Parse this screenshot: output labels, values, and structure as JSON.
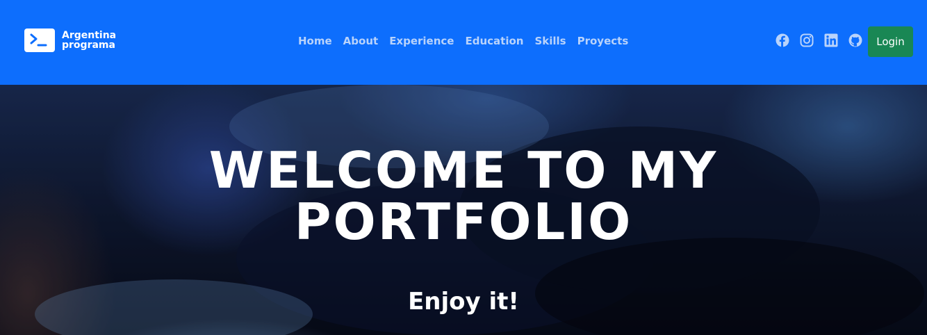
{
  "brand": {
    "line1": "Argentina",
    "line2": "programa",
    "logo_icon": "terminal-prompt-icon"
  },
  "nav": {
    "items": [
      {
        "label": "Home"
      },
      {
        "label": "About"
      },
      {
        "label": "Experience"
      },
      {
        "label": "Education"
      },
      {
        "label": "Skills"
      },
      {
        "label": "Proyects"
      }
    ]
  },
  "social": {
    "icons": [
      "facebook-icon",
      "instagram-icon",
      "linkedin-icon",
      "github-icon"
    ]
  },
  "login": {
    "label": "Login"
  },
  "hero": {
    "title_line1": "WELCOME TO MY",
    "title_line2": "PORTFOLIO",
    "subtitle": "Enjoy it!"
  },
  "colors": {
    "navbar": "#0d6efd",
    "nav_link": "#b9d3fb",
    "login_button": "#198754",
    "text": "#ffffff"
  }
}
